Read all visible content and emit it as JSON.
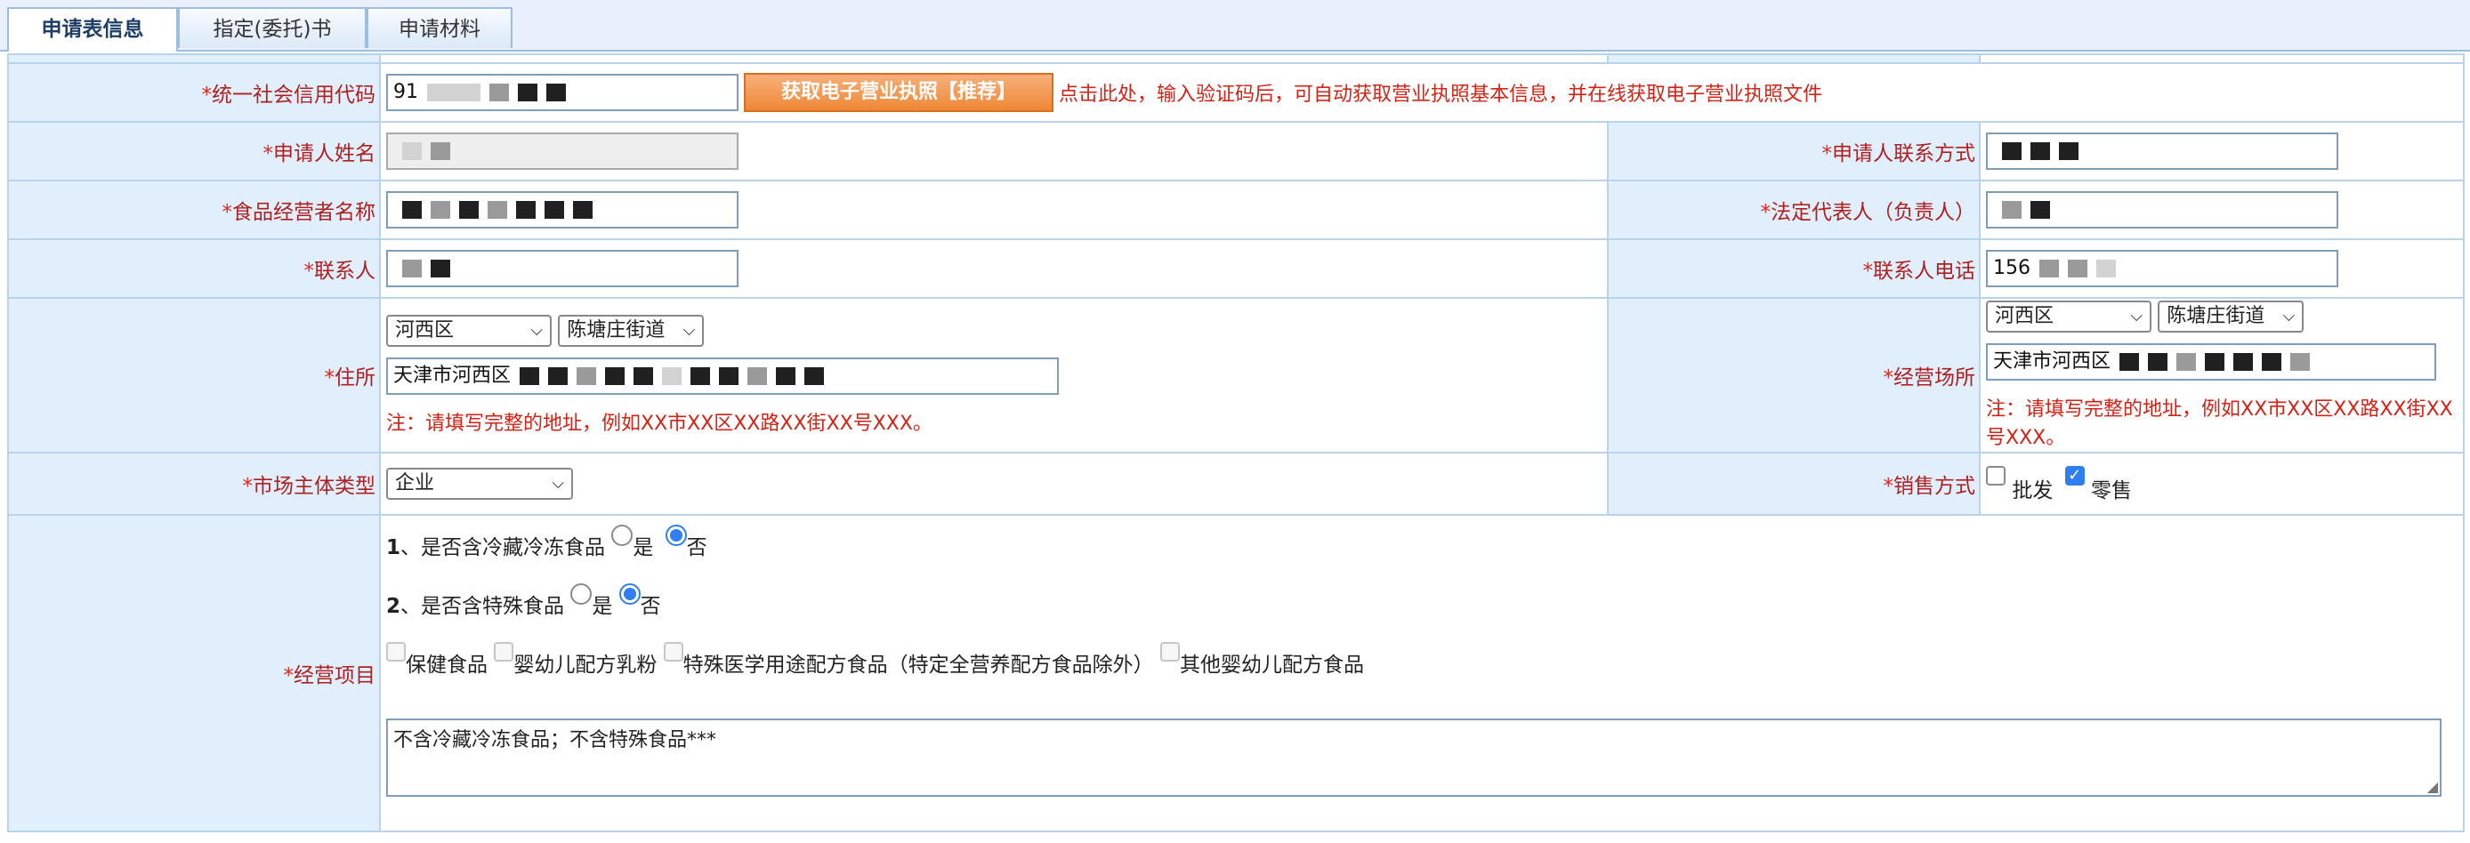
{
  "tabs": [
    {
      "label": "申请表信息",
      "active": true
    },
    {
      "label": "指定(委托)书",
      "active": false
    },
    {
      "label": "申请材料",
      "active": false
    }
  ],
  "required_mark": "*",
  "credit_code": {
    "label": "统一社会信用代码",
    "value": "91",
    "fetch_button": "获取电子营业执照【推荐】",
    "tip": "点击此处，输入验证码后，可自动获取营业执照基本信息，并在线获取电子营业执照文件"
  },
  "applicant_name": {
    "label": "申请人姓名"
  },
  "applicant_contact": {
    "label": "申请人联系方式"
  },
  "operator_name": {
    "label": "食品经营者名称"
  },
  "legal_rep": {
    "label": "法定代表人（负责人）"
  },
  "contact_person": {
    "label": "联系人"
  },
  "contact_phone": {
    "label": "联系人电话",
    "value": "156"
  },
  "residence": {
    "label": "住所",
    "district": "河西区",
    "street": "陈塘庄街道",
    "address": "天津市河西区",
    "note": "注：请填写完整的地址，例如XX市XX区XX路XX街XX号XXX。"
  },
  "business_place": {
    "label": "经营场所",
    "district": "河西区",
    "street": "陈塘庄街道",
    "address": "天津市河西区",
    "note": "注：请填写完整的地址，例如XX市XX区XX路XX街XX号XXX。"
  },
  "market_type": {
    "label": "市场主体类型",
    "value": "企业"
  },
  "sales_method": {
    "label": "销售方式",
    "options": [
      {
        "label": "批发",
        "checked": false
      },
      {
        "label": "零售",
        "checked": true
      }
    ]
  },
  "business_items": {
    "label": "经营项目",
    "q1": {
      "number": "1",
      "text": "、是否含冷藏冷冻食品",
      "yes": "是",
      "no": "否",
      "selected": "no"
    },
    "q2": {
      "number": "2",
      "text": "、是否含特殊食品",
      "yes": "是",
      "no": "否",
      "selected": "no"
    },
    "special_foods": [
      "保健食品",
      "婴幼儿配方乳粉",
      "特殊医学用途配方食品（特定全营养配方食品除外）",
      "其他婴幼儿配方食品"
    ],
    "summary": "不含冷藏冷冻食品；不含特殊食品***"
  }
}
